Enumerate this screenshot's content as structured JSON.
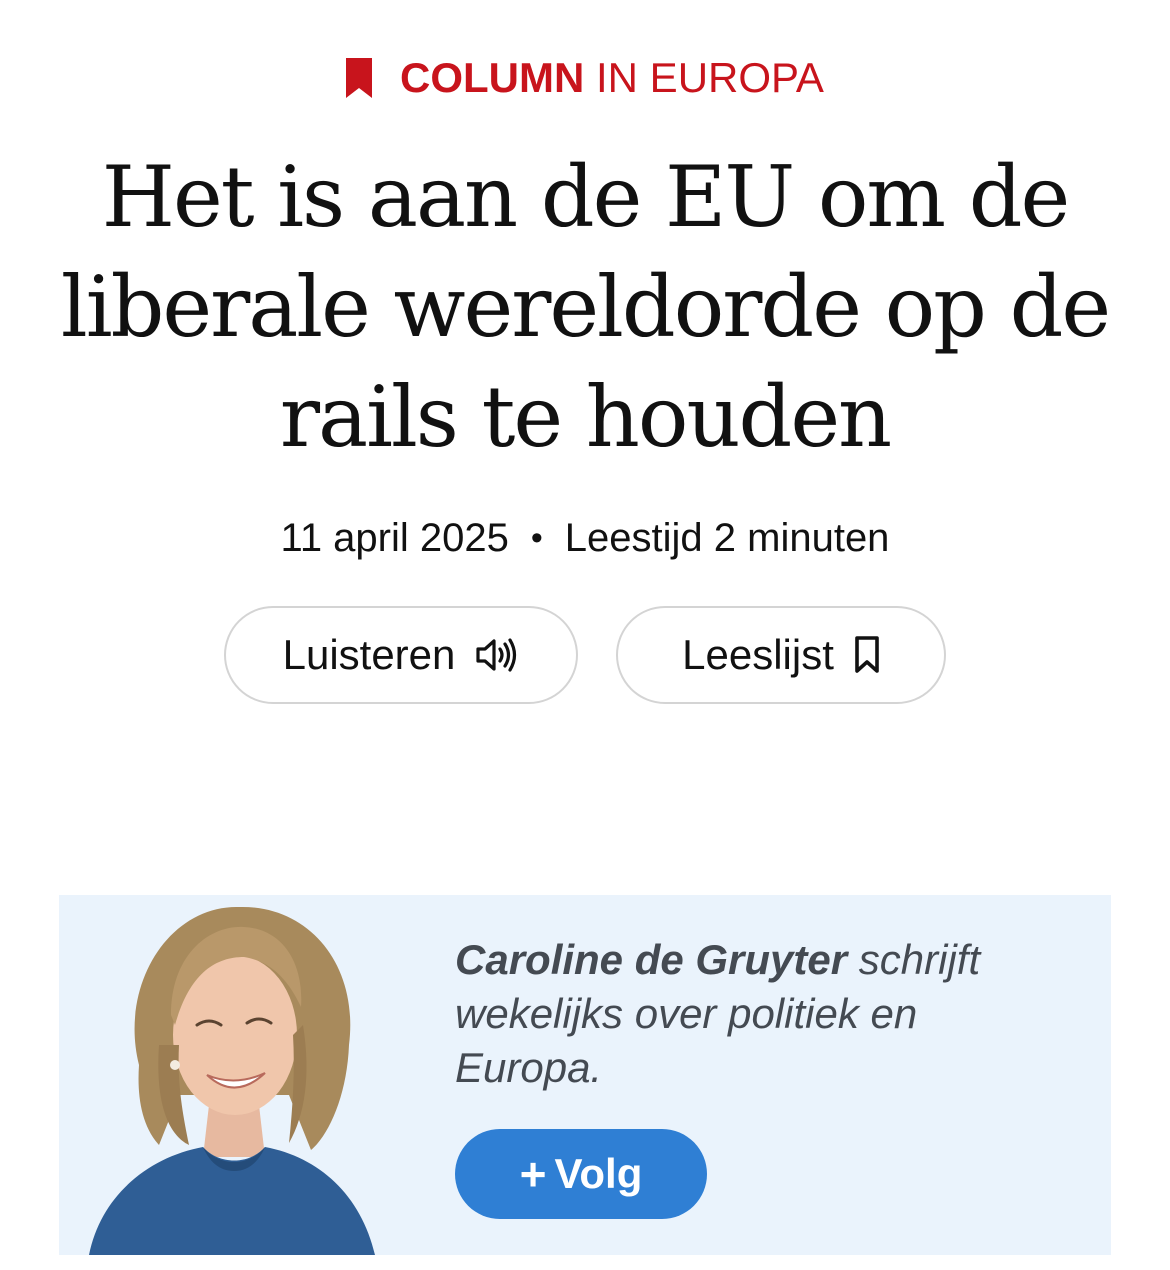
{
  "kicker": {
    "strong": "COLUMN",
    "rest": "IN EUROPA",
    "icon": "bookmark-icon",
    "color": "#c8141c"
  },
  "article": {
    "title": "Het is aan de EU om de liberale wereldorde op de rails te houden",
    "date": "11 april 2025",
    "separator": "•",
    "reading_time": "Leestijd 2 minuten"
  },
  "actions": {
    "listen_label": "Luisteren",
    "listen_icon": "speaker-icon",
    "readlist_label": "Leeslijst",
    "readlist_icon": "bookmark-icon"
  },
  "author": {
    "name": "Caroline de Gruyter",
    "bio": "schrijft wekelijks over politiek en Europa.",
    "follow_icon": "plus-icon",
    "follow_label": "Volg",
    "box_color": "#eaf3fc",
    "button_color": "#2f7fd4"
  }
}
